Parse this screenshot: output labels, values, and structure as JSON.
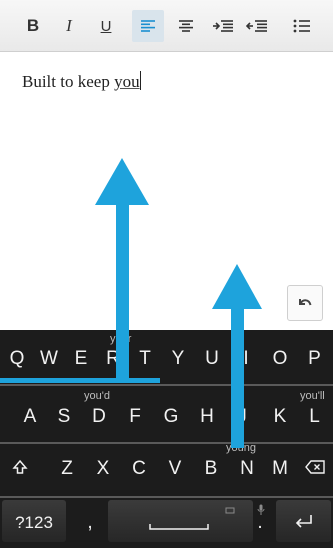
{
  "toolbar": {
    "bold": "B",
    "italic": "I",
    "underline": "U"
  },
  "editor": {
    "text_before": "Built to keep ",
    "text_underlined": "you"
  },
  "keyboard": {
    "row1": [
      "Q",
      "W",
      "E",
      "R",
      "T",
      "Y",
      "U",
      "I",
      "O",
      "P"
    ],
    "row2": [
      "A",
      "S",
      "D",
      "F",
      "G",
      "H",
      "J",
      "K",
      "L"
    ],
    "row3": [
      "Z",
      "X",
      "C",
      "V",
      "B",
      "N",
      "M"
    ],
    "symbols_key": "?123",
    "comma_key": ",",
    "period_key": ".",
    "suggestions": {
      "your": "your",
      "youd": "you'd",
      "youll": "you'll",
      "young": "young"
    }
  },
  "icons": {
    "align_left": "align-left-icon",
    "align_center": "align-center-icon",
    "indent": "indent-icon",
    "outdent": "outdent-icon",
    "list": "bullet-list-icon",
    "undo": "undo-icon",
    "shift": "shift-icon",
    "backspace": "backspace-icon",
    "enter": "enter-icon",
    "mic": "microphone-icon"
  },
  "colors": {
    "gesture_arrow": "#1ea3dc",
    "keyboard_bg": "#1c1c1c",
    "toolbar_active": "#d9e4ec"
  }
}
